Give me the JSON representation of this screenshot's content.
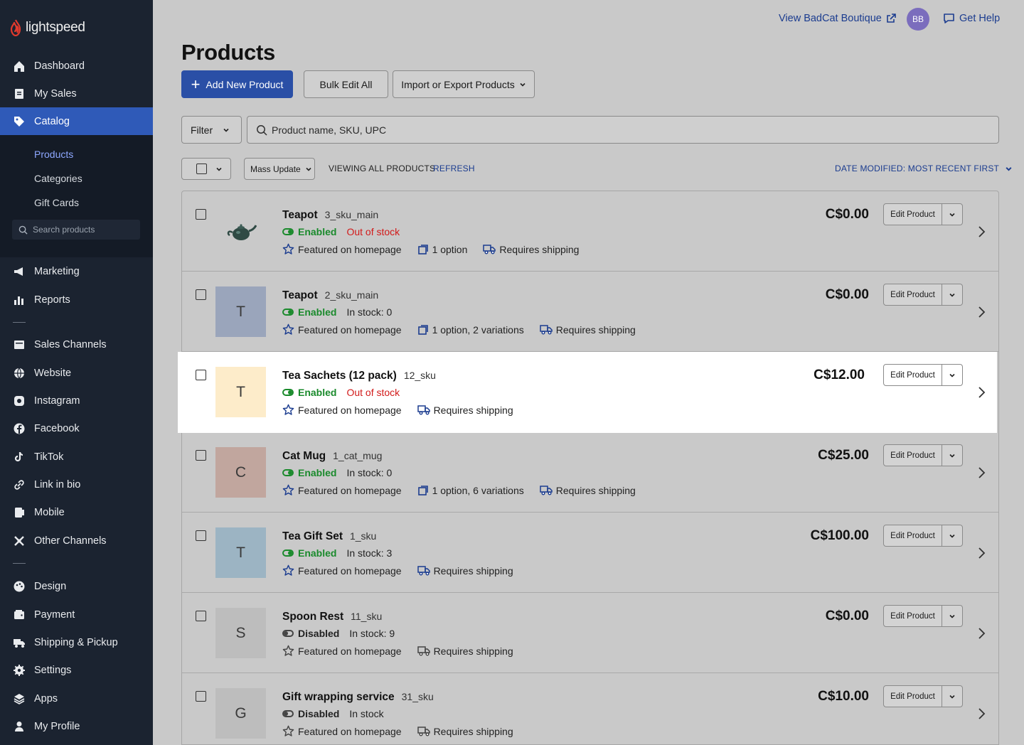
{
  "brand": {
    "name": "lightspeed"
  },
  "sidebar": {
    "items_top": [
      {
        "label": "Dashboard",
        "icon": "home-icon"
      },
      {
        "label": "My Sales",
        "icon": "receipt-icon"
      },
      {
        "label": "Catalog",
        "icon": "tag-icon",
        "active": true
      }
    ],
    "catalog_sub": [
      {
        "label": "Products",
        "active": true
      },
      {
        "label": "Categories"
      },
      {
        "label": "Gift Cards"
      }
    ],
    "search_placeholder": "Search products",
    "items_mid": [
      {
        "label": "Marketing",
        "icon": "megaphone-icon"
      },
      {
        "label": "Reports",
        "icon": "bar-chart-icon"
      }
    ],
    "items_channels": [
      {
        "label": "Sales Channels",
        "icon": "storefront-icon"
      },
      {
        "label": "Website",
        "icon": "globe-icon"
      },
      {
        "label": "Instagram",
        "icon": "instagram-icon"
      },
      {
        "label": "Facebook",
        "icon": "facebook-icon"
      },
      {
        "label": "TikTok",
        "icon": "tiktok-icon"
      },
      {
        "label": "Link in bio",
        "icon": "link-icon"
      },
      {
        "label": "Mobile",
        "icon": "mobile-icon"
      },
      {
        "label": "Other Channels",
        "icon": "channels-icon"
      }
    ],
    "items_bottom": [
      {
        "label": "Design",
        "icon": "palette-icon"
      },
      {
        "label": "Payment",
        "icon": "wallet-icon"
      },
      {
        "label": "Shipping & Pickup",
        "icon": "truck-icon"
      },
      {
        "label": "Settings",
        "icon": "gear-icon"
      },
      {
        "label": "Apps",
        "icon": "layers-icon"
      },
      {
        "label": "My Profile",
        "icon": "user-icon"
      }
    ]
  },
  "topbar": {
    "view_store": "View BadCat Boutique",
    "avatar_initials": "BB",
    "help": "Get Help"
  },
  "page": {
    "title": "Products",
    "add_new": "Add New Product",
    "bulk_edit": "Bulk Edit All",
    "import_export": "Import or Export Products",
    "filter": "Filter",
    "search_placeholder": "Product name, SKU, UPC",
    "mass_update": "Mass Update",
    "viewing": "VIEWING ALL PRODUCTS",
    "refresh": "REFRESH",
    "sort": "DATE MODIFIED: MOST RECENT FIRST"
  },
  "products": [
    {
      "name": "Teapot",
      "sku": "3_sku_main",
      "status": "Enabled",
      "stock": "Out of stock",
      "stock_out": true,
      "featured": "Featured on homepage",
      "options": "1 option",
      "shipping": "Requires shipping",
      "price": "C$0.00",
      "thumb_letter": "",
      "thumb_color": "",
      "thumb_image": "teapot",
      "featured_on": true
    },
    {
      "name": "Teapot",
      "sku": "2_sku_main",
      "status": "Enabled",
      "stock": "In stock: 0",
      "stock_out": false,
      "featured": "Featured on homepage",
      "options": "1 option, 2 variations",
      "shipping": "Requires shipping",
      "price": "C$0.00",
      "thumb_letter": "T",
      "thumb_color": "#9aa5bb",
      "featured_on": true
    },
    {
      "name": "Tea Sachets (12 pack)",
      "sku": "12_sku",
      "status": "Enabled",
      "stock": "Out of stock",
      "stock_out": true,
      "featured": "Featured on homepage",
      "options": "",
      "shipping": "Requires shipping",
      "price": "C$12.00",
      "thumb_letter": "T",
      "thumb_color": "#fdecca",
      "highlight": true,
      "featured_on": true
    },
    {
      "name": "Cat Mug",
      "sku": "1_cat_mug",
      "status": "Enabled",
      "stock": "In stock: 0",
      "stock_out": false,
      "featured": "Featured on homepage",
      "options": "1 option, 6 variations",
      "shipping": "Requires shipping",
      "price": "C$25.00",
      "thumb_letter": "C",
      "thumb_color": "#c1a69e",
      "featured_on": true
    },
    {
      "name": "Tea Gift Set",
      "sku": "1_sku",
      "status": "Enabled",
      "stock": "In stock: 3",
      "stock_out": false,
      "featured": "Featured on homepage",
      "options": "",
      "shipping": "Requires shipping",
      "price": "C$100.00",
      "thumb_letter": "T",
      "thumb_color": "#9cb4c3",
      "featured_on": true
    },
    {
      "name": "Spoon Rest",
      "sku": "11_sku",
      "status": "Disabled",
      "stock": "In stock: 9",
      "stock_out": false,
      "featured": "Featured on homepage",
      "options": "",
      "shipping": "Requires shipping",
      "price": "C$0.00",
      "thumb_letter": "S",
      "thumb_color": "#bdbdbd",
      "featured_on": false
    },
    {
      "name": "Gift wrapping service",
      "sku": "31_sku",
      "status": "Disabled",
      "stock": "In stock",
      "stock_out": false,
      "featured": "Featured on homepage",
      "options": "",
      "shipping": "Requires shipping",
      "price": "C$10.00",
      "thumb_letter": "G",
      "thumb_color": "#bdbdbd",
      "featured_on": false
    }
  ],
  "row_actions": {
    "edit": "Edit Product"
  },
  "colors": {
    "sidebar": "#1b2330",
    "active": "#2f5ab8",
    "link": "#1b3c8f",
    "enabled": "#1a8a2c",
    "out_of_stock": "#d21a1a"
  }
}
